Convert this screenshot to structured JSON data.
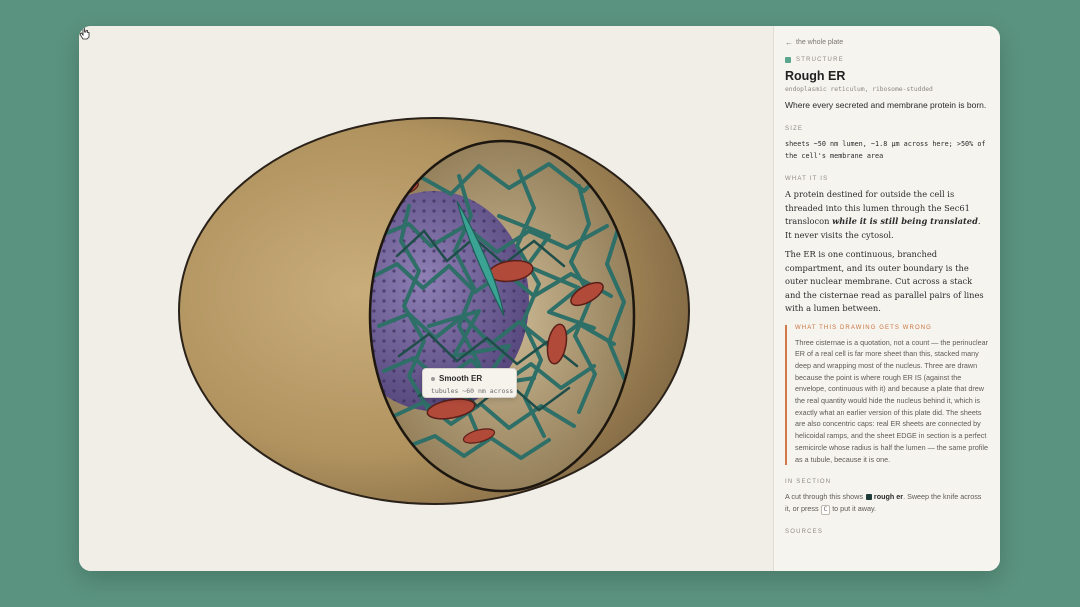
{
  "panel": {
    "back_link": "the whole plate",
    "eyebrow": "STRUCTURE",
    "title": "Rough ER",
    "subtitle": "endoplasmic reticulum, ribosome-studded",
    "lead": "Where every secreted and membrane protein is born.",
    "size_label": "SIZE",
    "size_text": "sheets ~50 nm lumen, ~1.8 µm across here; >50% of the cell's membrane area",
    "what_label": "WHAT IT IS",
    "para1_a": "A protein destined for outside the cell is threaded into this lumen through the Sec61 translocon ",
    "para1_em": "while it is still being translated",
    "para1_b": ". It never visits the cytosol.",
    "para2": "The ER is one continuous, branched compartment, and its outer boundary is the outer nuclear membrane. Cut across a stack and the cisternae read as parallel pairs of lines with a lumen between.",
    "wrong_label": "WHAT THIS DRAWING GETS WRONG",
    "wrong_text": "Three cisternae is a quotation, not a count — the perinuclear ER of a real cell is far more sheet than this, stacked many deep and wrapping most of the nucleus. Three are drawn because the point is where rough ER IS (against the envelope, continuous with it) and because a plate that drew the real quantity would hide the nucleus behind it, which is exactly what an earlier version of this plate did. The sheets are also concentric caps: real ER sheets are connected by helicoidal ramps, and the sheet EDGE in section is a perfect semicircle whose radius is half the lumen — the same profile as a tubule, because it is one.",
    "insection_label": "IN SECTION",
    "insection_a": "A cut through this shows",
    "insection_b": "rough er",
    "insection_c": ". Sweep the knife across it, or press",
    "insection_key": "C",
    "insection_d": "to put it away.",
    "sources_label": "SOURCES"
  },
  "tooltip": {
    "title": "Smooth ER",
    "subtitle": "tubules ~60 nm across"
  },
  "colors": {
    "background": "#5a937f",
    "shell": "#b39868",
    "er_teal": "#2e6f68",
    "nucleus": "#6e5e93",
    "mito": "#b24a3a",
    "accent": "#d07a4a"
  }
}
